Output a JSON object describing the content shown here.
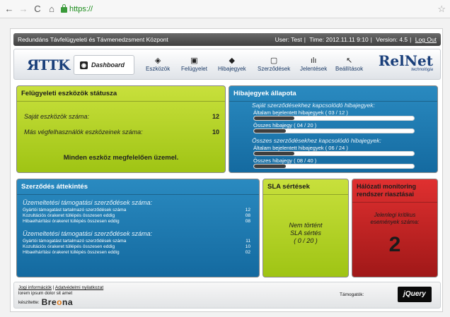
{
  "browser": {
    "back_icon": "←",
    "forward_icon": "→",
    "reload_icon": "C",
    "home_icon": "⌂",
    "url": "https://",
    "star_icon": "☆"
  },
  "topbar": {
    "title": "Redundáns Távfelügyeleti és Távmenedzsment Központ",
    "user": "User: Test",
    "time": "Time: 2012.11.11 9:10",
    "version": "Version: 4.5",
    "logout": "Log Out"
  },
  "menu": {
    "logo_left": "ЯTTK",
    "dashboard": "Dashboard",
    "items": [
      {
        "label": "Eszközök",
        "icon": "◈"
      },
      {
        "label": "Felügyelet",
        "icon": "▣"
      },
      {
        "label": "Hibajegyek",
        "icon": "◆"
      },
      {
        "label": "Szerződések",
        "icon": "▢"
      },
      {
        "label": "Jelentések",
        "icon": "ılı"
      },
      {
        "label": "Beállítások",
        "icon": "↖"
      }
    ],
    "logo_right": "RelNet",
    "logo_right_sub": "technológia"
  },
  "status_panel": {
    "title": "Felügyeleti eszközök státusza",
    "own_label": "Saját eszközök száma:",
    "own_value": "12",
    "other_label": "Más végfelhasználók eszközeinek száma:",
    "other_value": "10",
    "message": "Minden eszköz megfelelően üzemel."
  },
  "tickets_panel": {
    "title": "Hibajegyek állapota",
    "group1_title": "Saját szerződésekhez kapcsolódó hibajegyek:",
    "group1_reported": "Általam bejelentett hibajegyek ( 03 / 12 )",
    "group1_reported_ratio": 0.25,
    "group1_total": "Összes hibajegy ( 04 / 20 )",
    "group1_total_ratio": 0.2,
    "group2_title": "Összes szerződésekhez kapcsolódó hibajegyek:",
    "group2_reported": "Általam bejelentett hibajegyek ( 06 / 24 )",
    "group2_reported_ratio": 0.25,
    "group2_total": "Összes hibajegy ( 08 / 40 )",
    "group2_total_ratio": 0.2
  },
  "contracts_panel": {
    "title": "Szerződés áttekintés",
    "section1_title": "Üzemeltetési támogatási szerződések száma:",
    "section1_rows": [
      {
        "label": "Gyártói támogatást tartalmazó szerződések száma",
        "value": "12"
      },
      {
        "label": "Kozultációs órakeret túllépés összesen eddig",
        "value": "08"
      },
      {
        "label": "Hibaelhárítási órakeret túllépés összesen eddig",
        "value": "08"
      }
    ],
    "section2_title": "Üzemeltetési támogatási szerződések száma:",
    "section2_rows": [
      {
        "label": "Gyártói támogatást tartalmazó szerződések száma",
        "value": "11"
      },
      {
        "label": "Kozultációs órakeret túllépés összesen eddig",
        "value": "10"
      },
      {
        "label": "Hibaelhárítási órakeret túllépés összesen eddig",
        "value": "02"
      }
    ]
  },
  "sla_panel": {
    "title": "SLA sértések",
    "line1": "Nem történt",
    "line2": "SLA sértés",
    "line3": "( 0 / 20 )"
  },
  "monitor_panel": {
    "title": "Hálózati monitoring rendszer riasztásai",
    "line1": "Jelenlegi kritikus",
    "line2": "események száma:",
    "count": "2"
  },
  "footer": {
    "link1": "Jogi információk",
    "link2": "Adatvédelmi nyilatkozat",
    "lorem": "lorem ipsum dolor sit amet",
    "made_by": "készítette:",
    "brand_pre": "Bre",
    "brand_o": "o",
    "brand_post": "na",
    "support": "Támogatók:",
    "jquery": "jQuery"
  }
}
